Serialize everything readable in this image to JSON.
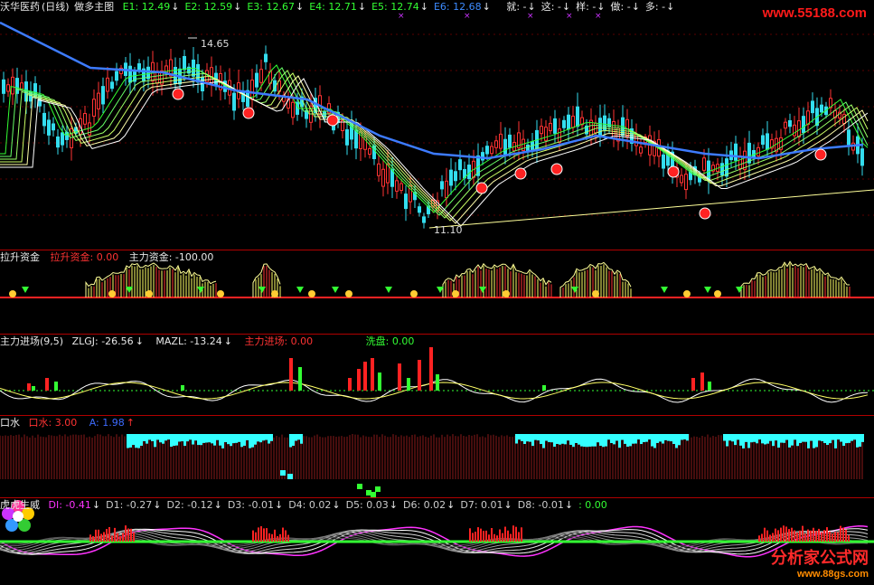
{
  "main": {
    "stock_name": "沃华医药",
    "period": "(日线)",
    "indicator": "做多主图",
    "ema": [
      {
        "label": "E1: 12.49",
        "arrow": "↓",
        "color": "#33ff33"
      },
      {
        "label": "E2: 12.59",
        "arrow": "↓",
        "color": "#33ff33"
      },
      {
        "label": "E3: 12.67",
        "arrow": "↓",
        "color": "#33ff33"
      },
      {
        "label": "E4: 12.71",
        "arrow": "↓",
        "color": "#33ff33"
      },
      {
        "label": "E5: 12.74",
        "arrow": "↓",
        "color": "#33ff33"
      },
      {
        "label": "E6: 12.68",
        "arrow": "↓",
        "color": "#3d8bff"
      }
    ],
    "signals": [
      {
        "label": "就: -",
        "arrow": "↓"
      },
      {
        "label": "这: -",
        "arrow": "↓"
      },
      {
        "label": "样: -",
        "arrow": "↓"
      },
      {
        "label": "做: -",
        "arrow": "↓"
      },
      {
        "label": "多: -",
        "arrow": "↓"
      }
    ],
    "high_label": "14.65",
    "low_label": "11.10"
  },
  "lashen": {
    "title": "拉升资金",
    "l1": "拉升资金: 0.00",
    "l2": "主力资金: -100.00"
  },
  "zhuli": {
    "title": "主力进场(9,5)",
    "zlgj": "ZLGJ: -26.56",
    "zlgj_arrow": "↓",
    "mazl": "MAZL: -13.24",
    "mazl_arrow": "↓",
    "enter": "主力进场: 0.00",
    "wash": "洗盘: 0.00"
  },
  "koushui": {
    "title": "口水",
    "k": "口水: 3.00",
    "a": "A: 1.98",
    "a_arrow": "↑"
  },
  "huhu": {
    "title": "虎虎生威",
    "items": [
      {
        "label": "DI: -0.41",
        "arrow": "↓",
        "color": "#ff33ff"
      },
      {
        "label": "D1: -0.27",
        "arrow": "↓",
        "color": "#cccccc"
      },
      {
        "label": "D2: -0.12",
        "arrow": "↓",
        "color": "#cccccc"
      },
      {
        "label": "D3: -0.01",
        "arrow": "↓",
        "color": "#cccccc"
      },
      {
        "label": "D4: 0.02",
        "arrow": "↓",
        "color": "#cccccc"
      },
      {
        "label": "D5: 0.03",
        "arrow": "↓",
        "color": "#cccccc"
      },
      {
        "label": "D6: 0.02",
        "arrow": "↓",
        "color": "#cccccc"
      },
      {
        "label": "D7: 0.01",
        "arrow": "↓",
        "color": "#cccccc"
      },
      {
        "label": "D8: -0.01",
        "arrow": "↓",
        "color": "#cccccc"
      },
      {
        "label": ": 0.00",
        "arrow": "",
        "color": "#33ff33"
      }
    ]
  },
  "watermark_top": "www.55188.com",
  "watermark_bottom": {
    "line1": "分析家公式网",
    "line2": "www.88gs.com"
  }
}
